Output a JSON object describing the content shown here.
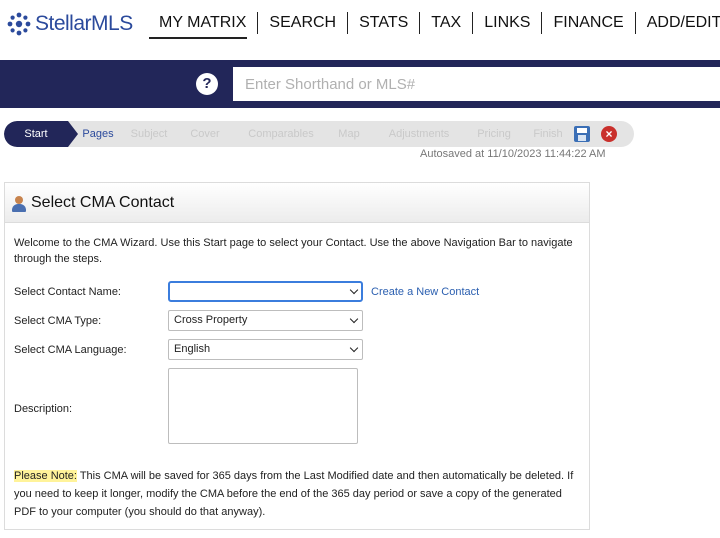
{
  "brand": {
    "logo_text_a": "Stellar",
    "logo_text_b": "MLS",
    "accent": "#2b4a9c",
    "nav_bg": "#222659"
  },
  "nav": {
    "items": [
      {
        "label": "MY MATRIX",
        "active": true
      },
      {
        "label": "SEARCH"
      },
      {
        "label": "STATS"
      },
      {
        "label": "TAX"
      },
      {
        "label": "LINKS"
      },
      {
        "label": "FINANCE"
      },
      {
        "label": "ADD/EDIT"
      }
    ]
  },
  "search": {
    "help_icon": "?",
    "placeholder": "Enter Shorthand or MLS#"
  },
  "wizard": {
    "steps": [
      "Start",
      "Pages",
      "Subject",
      "Cover",
      "Comparables",
      "Map",
      "Adjustments",
      "Pricing",
      "Finish"
    ],
    "autosaved": "Autosaved at 11/10/2023 11:44:22 AM"
  },
  "panel": {
    "title": "Select CMA Contact",
    "intro": "Welcome to the CMA Wizard. Use this Start page to select your Contact. Use the above Navigation Bar to navigate through the steps.",
    "contact_label": "Select Contact Name:",
    "contact_value": "",
    "create_link": "Create a New Contact",
    "type_label": "Select CMA Type:",
    "type_value": "Cross Property",
    "language_label": "Select CMA Language:",
    "language_value": "English",
    "description_label": "Description:",
    "note_label": "Please Note:",
    "note_text": " This CMA will be saved for 365 days from the Last Modified date and then automatically be deleted. If you need to keep it longer, modify the CMA before the end of the 365 day period or save a copy of the generated PDF to your computer (you should do that anyway)."
  }
}
